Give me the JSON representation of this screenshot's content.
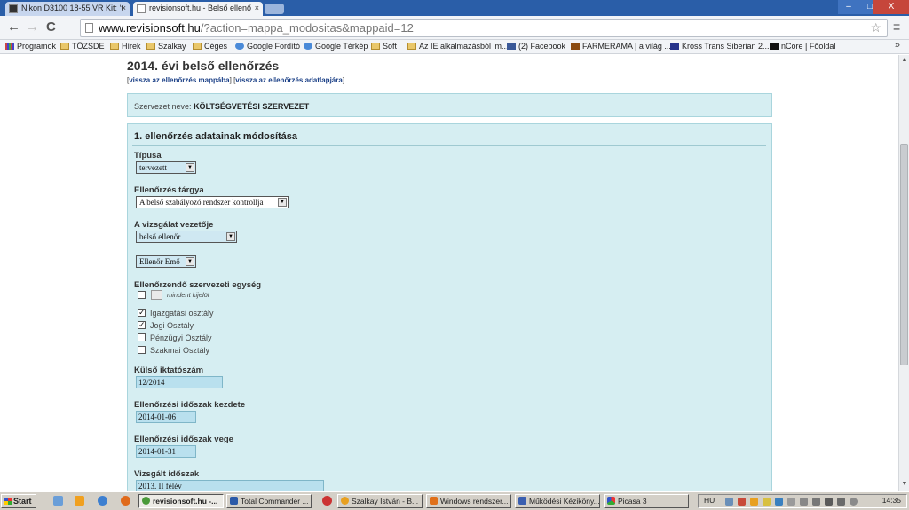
{
  "browser": {
    "tabs": [
      {
        "label": "Nikon D3100 18-55 VR Kit: ‘t",
        "active": false
      },
      {
        "label": "revisionsoft.hu - Belső ellenő",
        "active": true
      }
    ],
    "window_buttons": {
      "minimize": "–",
      "restore": "□",
      "close": "X"
    },
    "nav": {
      "back": "←",
      "forward": "→",
      "reload": "C"
    },
    "url_host": "www.revisionsoft.hu",
    "url_path": "/?action=mappa_modositas&mappaid=12",
    "star": "☆",
    "menu": "≡"
  },
  "bookmarks": {
    "items": [
      {
        "label": "Programok",
        "icon": "apps-grid-icon"
      },
      {
        "label": "TÖZSDE",
        "icon": "folder-icon"
      },
      {
        "label": "Hírek",
        "icon": "folder-icon"
      },
      {
        "label": "Szalkay",
        "icon": "folder-icon"
      },
      {
        "label": "Céges",
        "icon": "folder-icon"
      },
      {
        "label": "Google Fordító",
        "icon": "google-translate-icon"
      },
      {
        "label": "Google Térkép",
        "icon": "google-maps-icon"
      },
      {
        "label": "Soft",
        "icon": "folder-icon"
      },
      {
        "label": "Az IE alkalmazásból im...",
        "icon": "folder-icon"
      },
      {
        "label": "(2) Facebook",
        "icon": "facebook-icon"
      },
      {
        "label": "FARMERAMA | a világ ...",
        "icon": "farmerama-icon"
      },
      {
        "label": "Kross Trans Siberian 2...",
        "icon": "kross-icon"
      },
      {
        "label": "nCore | Főoldal",
        "icon": "ncore-icon"
      }
    ],
    "more": "»"
  },
  "page": {
    "title": "2014. évi belső ellenőrzés",
    "crumb_1": "vissza az ellenőrzés mappába",
    "crumb_2": "vissza az ellenőrzés adatlapjára",
    "org_label": "Szervezet neve:",
    "org_value": "KÖLTSÉGVETÉSI SZERVEZET",
    "section_title": "1. ellenőrzés adatainak módosítása",
    "form": {
      "type_label": "Típusa",
      "type_value": "tervezett",
      "subject_label": "Ellenőrzés tárgya",
      "subject_value": "A belső szabályozó rendszer kontrollja",
      "leader_label": "A vizsgálat vezetője",
      "leader_value": "belső ellenőr",
      "person_value": "Ellenőr Emő",
      "units_label": "Ellenőrzendő szervezeti egység",
      "select_all": "mindent kijelöl",
      "units": [
        {
          "label": "Igazgatási osztály",
          "checked": true
        },
        {
          "label": "Jogi Osztály",
          "checked": true
        },
        {
          "label": "Pénzügyi Osztály",
          "checked": false
        },
        {
          "label": "Szakmai Osztály",
          "checked": false
        }
      ],
      "ext_ref_label": "Külső iktatószám",
      "ext_ref_value": "12/2014",
      "period_start_label": "Ellenőrzési időszak kezdete",
      "period_start_value": "2014-01-06",
      "period_end_label": "Ellenőrzési időszak vege",
      "period_end_value": "2014-01-31",
      "examined_label": "Vizsgált időszak",
      "examined_value": "2013. II félév"
    }
  },
  "taskbar": {
    "start": "Start",
    "tasks": [
      {
        "label": "revisionsoft.hu -...",
        "active": true
      },
      {
        "label": "Total Commander ...",
        "active": false
      },
      {
        "label": "Szalkay István - B...",
        "active": false
      },
      {
        "label": "Windows rendszer...",
        "active": false
      },
      {
        "label": "Működési Kéziköny...",
        "active": false
      },
      {
        "label": "Picasa 3",
        "active": false
      }
    ],
    "lang": "HU",
    "clock": "14:35"
  },
  "colors": {
    "panel_bg": "#d6eef2",
    "panel_border": "#a9d5dd",
    "link": "#1a3f86",
    "titlebar": "#2a5ea8"
  }
}
